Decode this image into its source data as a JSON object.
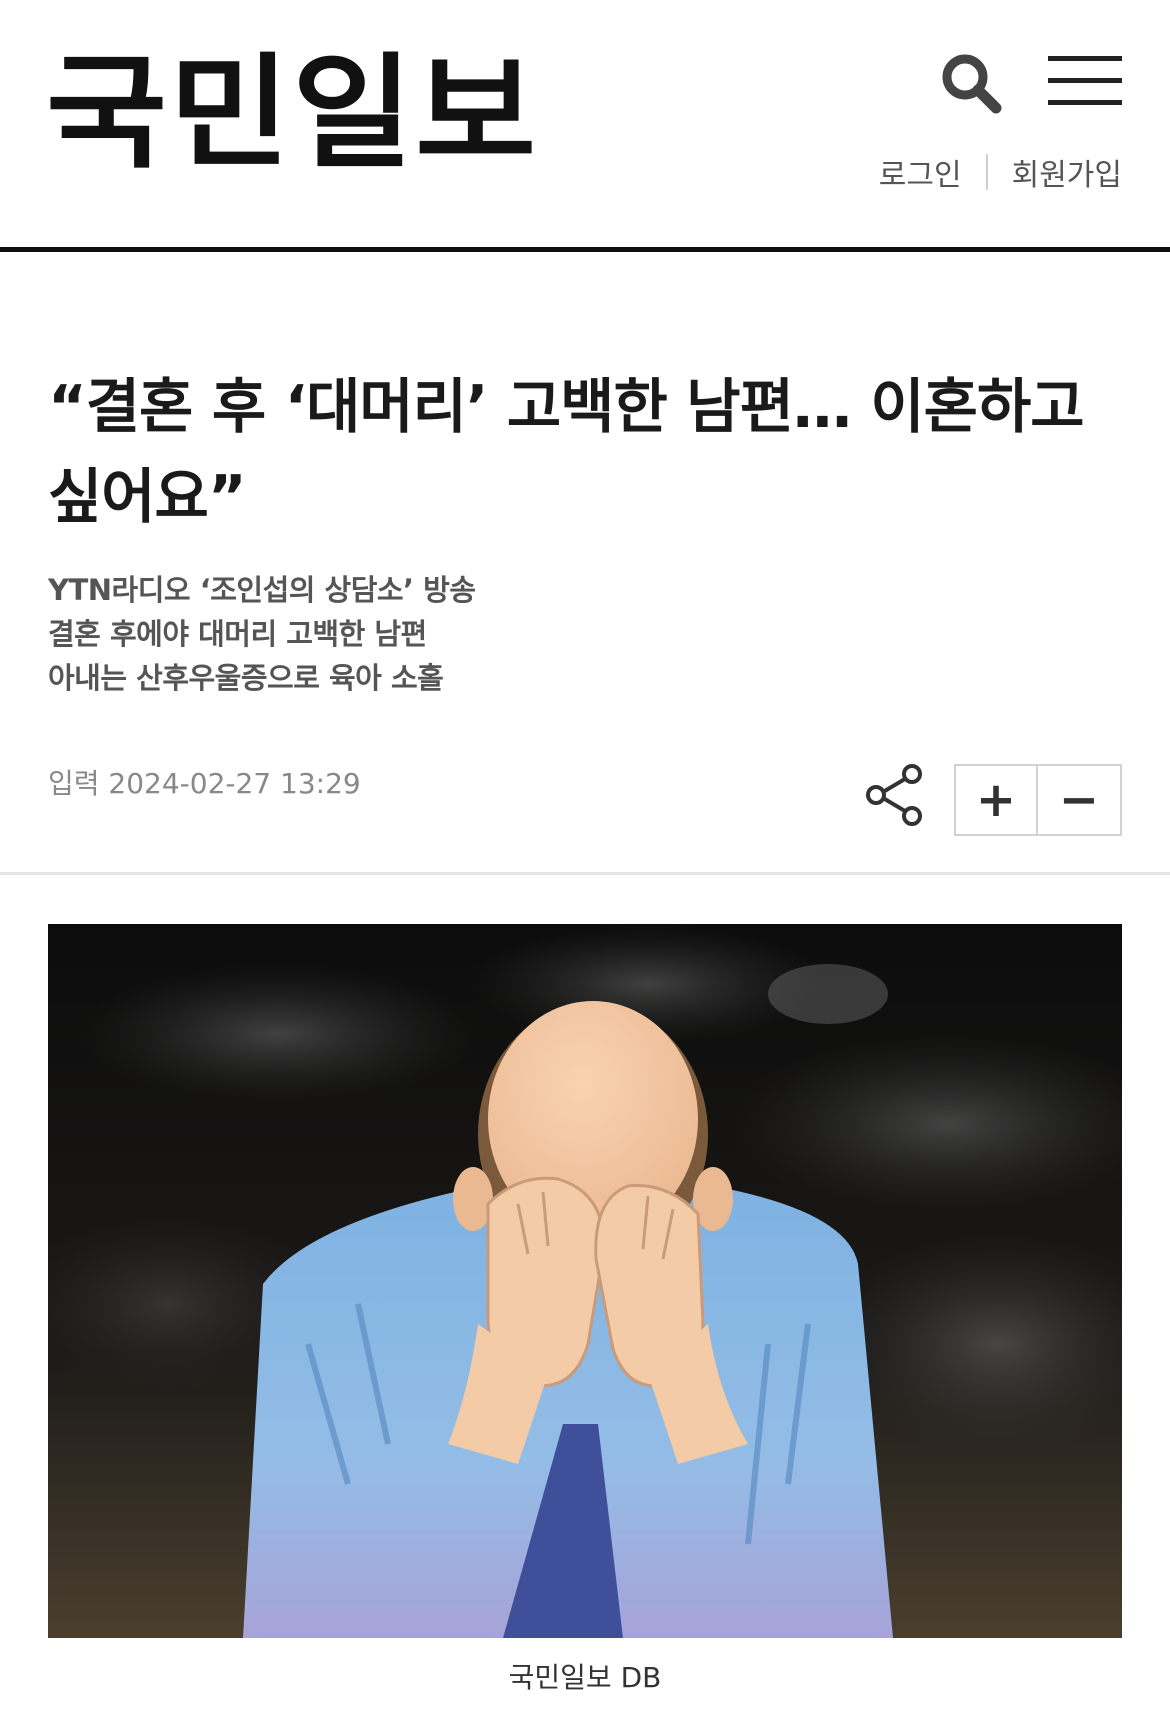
{
  "header": {
    "logo_text": "국민일보",
    "login_label": "로그인",
    "signup_label": "회원가입"
  },
  "article": {
    "title": "“결혼 후 ‘대머리’ 고백한 남편… 이혼하고 싶어요”",
    "subtitles": [
      "YTN라디오 ‘조인섭의 상담소’ 방송",
      "결혼 후에야 대머리 고백한 남편",
      "아내는 산후우울증으로 육아 소홀"
    ],
    "published": "입력 2024-02-27 13:29",
    "font_increase_label": "+",
    "font_decrease_label": "−",
    "image_caption": "국민일보 DB"
  },
  "icons": {
    "search": "search-icon",
    "menu": "hamburger-menu-icon",
    "share": "share-icon"
  },
  "colors": {
    "text_primary": "#1a1a1a",
    "text_secondary": "#555555",
    "text_meta": "#888888",
    "rule": "#111111"
  }
}
